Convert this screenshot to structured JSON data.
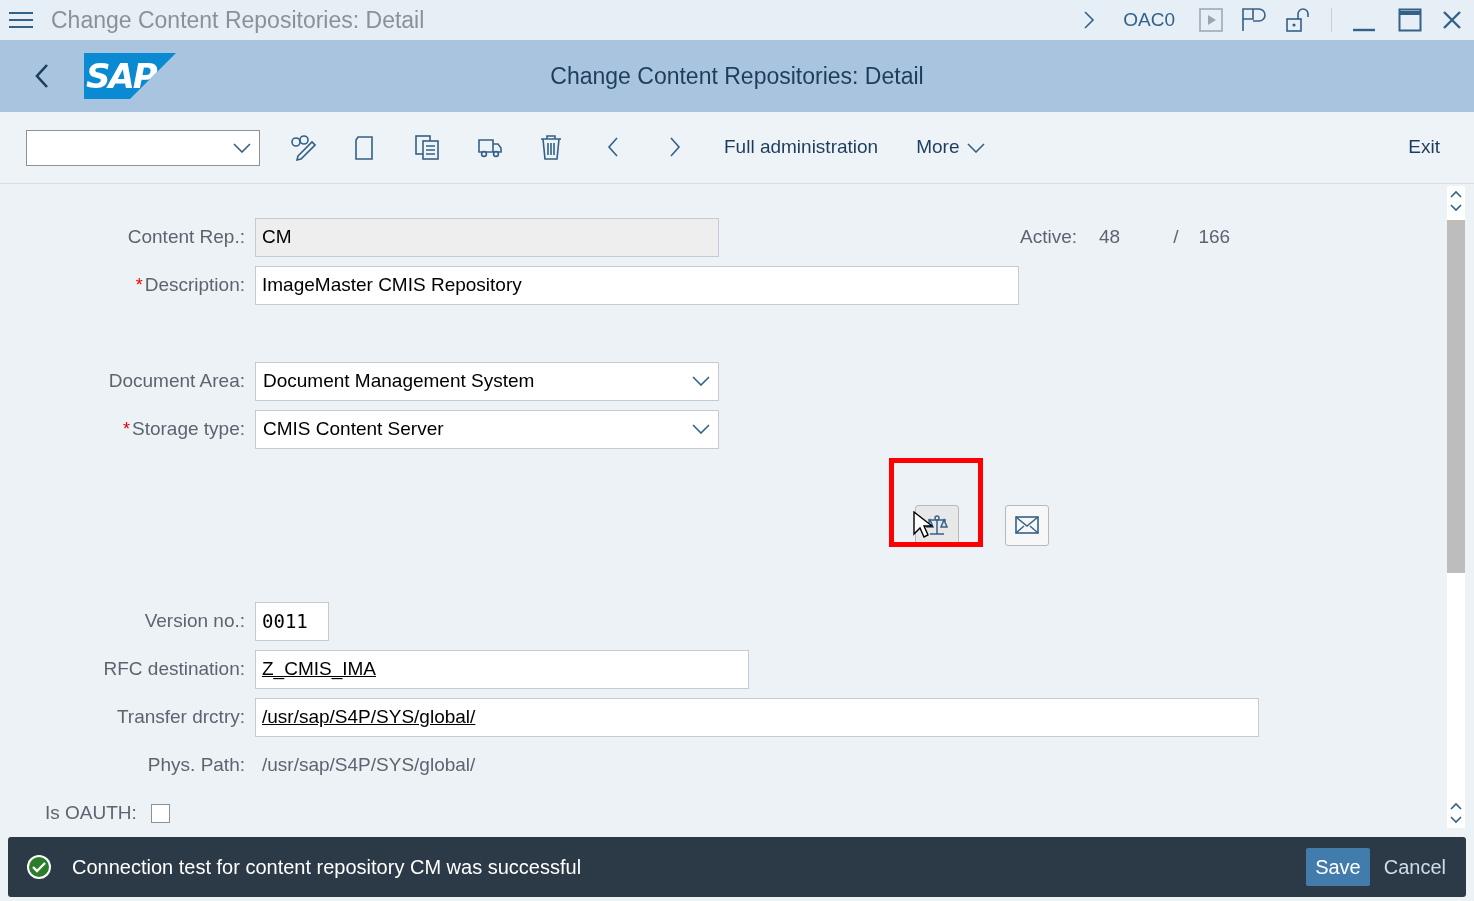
{
  "title_bar": {
    "title": "Change Content Repositories: Detail",
    "transaction": "OAC0"
  },
  "header": {
    "logo": "SAP",
    "title": "Change Content Repositories: Detail"
  },
  "toolbar": {
    "text_buttons": [
      {
        "label": "Full administration",
        "kind": "plain"
      },
      {
        "label": "More",
        "kind": "menu"
      }
    ],
    "exit": "Exit"
  },
  "form": {
    "content_rep": {
      "label": "Content Rep.:",
      "value": "CM"
    },
    "active": {
      "label": "Active:",
      "current": "48",
      "separator": "/",
      "total": "166"
    },
    "groups": [
      [
        {
          "label": "Description:",
          "value": "ImageMaster CMIS Repository",
          "kind": "input",
          "required": true
        }
      ],
      [
        {
          "label": "Document Area:",
          "value": "Document Management System",
          "kind": "dropdown",
          "required": false
        },
        {
          "label": "Storage type:",
          "value": "CMIS Content Server",
          "kind": "dropdown",
          "required": true
        }
      ],
      [
        {
          "label": "Version no.:",
          "value": "0011",
          "kind": "mono",
          "required": false
        },
        {
          "label": "RFC destination:",
          "value": "Z_CMIS_IMA",
          "kind": "link",
          "required": false
        },
        {
          "label": "Transfer drctry:",
          "value": "/usr/sap/S4P/SYS/global/",
          "kind": "link",
          "required": false
        },
        {
          "label": "Phys. Path:",
          "value": "/usr/sap/S4P/SYS/global/",
          "kind": "text",
          "required": false
        }
      ]
    ],
    "oauth": {
      "label": "Is OAUTH:",
      "checked": false
    },
    "required_mark": "*"
  },
  "message": {
    "kind": "success",
    "text": "Connection test for content repository CM was successful"
  },
  "footer_buttons": [
    {
      "label": "Save",
      "primary": true
    },
    {
      "label": "Cancel",
      "primary": false
    }
  ]
}
